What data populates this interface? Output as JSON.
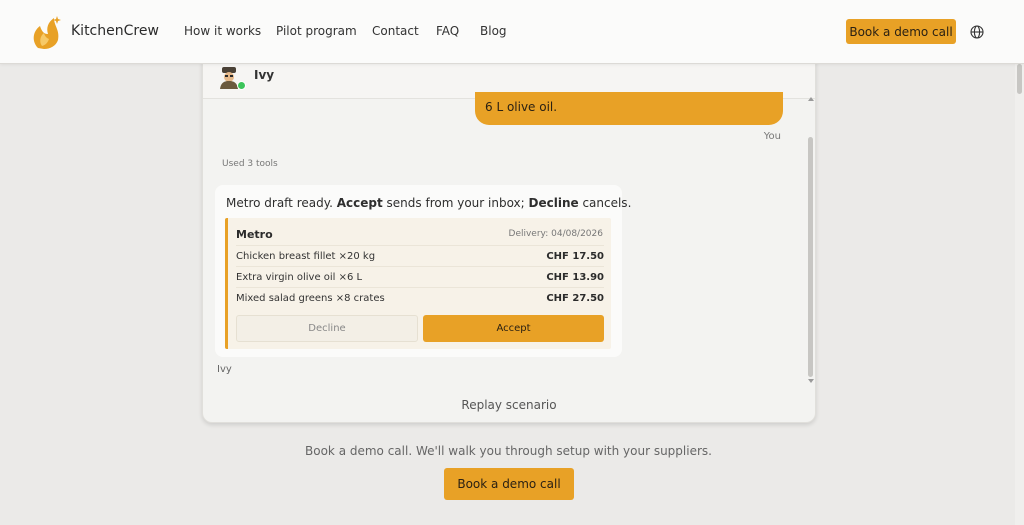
{
  "header": {
    "brand": "KitchenCrew",
    "nav": [
      "How it works",
      "Pilot program",
      "Contact",
      "FAQ",
      "Blog"
    ],
    "cta_label": "Book a demo call",
    "icons": {
      "logo": "chef-logo-icon",
      "globe": "globe-icon"
    }
  },
  "chat": {
    "agent_name": "Ivy",
    "user_message": "6 L olive oil.",
    "user_label": "You",
    "tools_used": "Used 3 tools",
    "agent_message": {
      "part1": "Metro draft ready. ",
      "accept_word": "Accept",
      "part2": " sends from your inbox; ",
      "decline_word": "Decline",
      "part3": " cancels."
    },
    "order": {
      "supplier": "Metro",
      "delivery": "Delivery: 04/08/2026",
      "lines": [
        {
          "name": "Chicken breast fillet ×20 kg",
          "price": "CHF 17.50"
        },
        {
          "name": "Extra virgin olive oil ×6 L",
          "price": "CHF 13.90"
        },
        {
          "name": "Mixed salad greens ×8 crates",
          "price": "CHF 27.50"
        }
      ],
      "decline_label": "Decline",
      "accept_label": "Accept"
    },
    "agent_label": "Ivy",
    "replay_label": "Replay scenario"
  },
  "footer": {
    "text": "Book a demo call. We'll walk you through setup with your suppliers.",
    "cta_label": "Book a demo call"
  },
  "colors": {
    "accent": "#e8a126",
    "online": "#3cc45a",
    "background": "#ebeae8"
  }
}
